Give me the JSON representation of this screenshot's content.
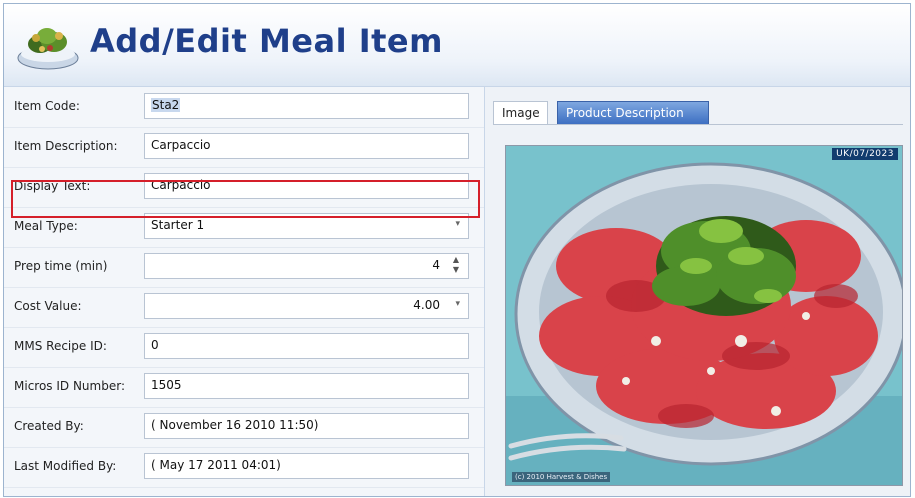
{
  "header": {
    "title": "Add/Edit Meal Item",
    "logo_icon": "salad-bowl-icon"
  },
  "form": {
    "rows": [
      {
        "label": "Item Code:",
        "value": "Sta2"
      },
      {
        "label": "Item Description:",
        "value": "Carpaccio"
      },
      {
        "label": "Display Text:",
        "value": "Carpaccio"
      },
      {
        "label": "Meal Type:",
        "value": "Starter 1"
      },
      {
        "label": "Prep time (min)",
        "value": "4"
      },
      {
        "label": "Cost Value:",
        "value": "4.00"
      },
      {
        "label": "MMS Recipe ID:",
        "value": "0"
      },
      {
        "label": "Micros ID Number:",
        "value": "1505"
      },
      {
        "label": "Created By:",
        "value": "( November 16 2010 11:50)"
      },
      {
        "label": "Last Modified By:",
        "value": "( May 17 2011 04:01)"
      }
    ]
  },
  "tabs": [
    {
      "label": "Image",
      "active": true
    },
    {
      "label": "Product Description",
      "active": false
    }
  ],
  "image": {
    "badge": "UK/07/2023",
    "caption": "(c) 2010 Harvest & Dishes"
  },
  "colors": {
    "title": "#1f3f8a",
    "highlight_border": "#d51f2a",
    "tab_active_bg": "#3d6fc2"
  }
}
